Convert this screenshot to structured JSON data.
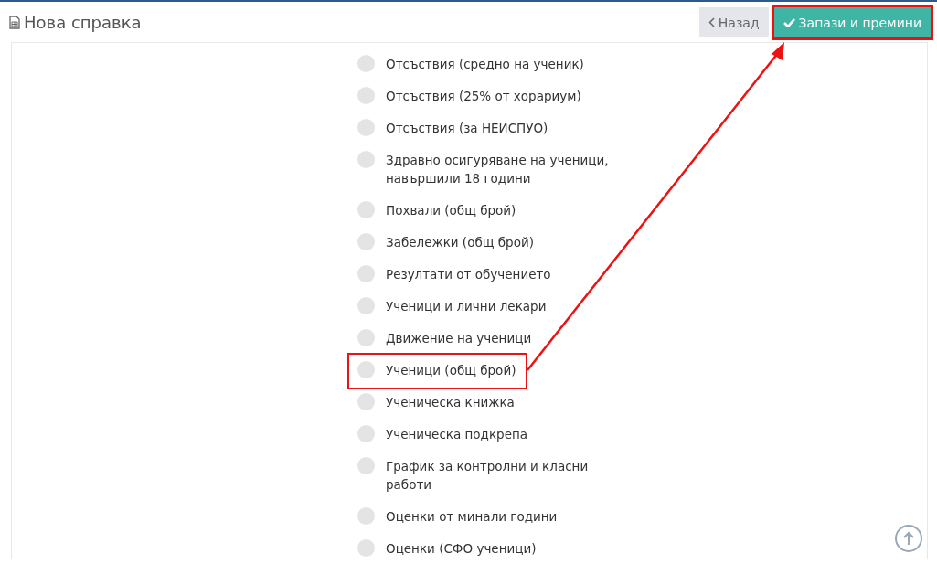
{
  "page": {
    "title": "Нова справка"
  },
  "buttons": [
    {
      "kind": "back",
      "label": "Назад",
      "highlighted": false
    },
    {
      "kind": "save",
      "label": "Запази и премини",
      "highlighted": true
    }
  ],
  "options": [
    {
      "label": "Отсъствия (средно на ученик)",
      "selected": false,
      "highlighted": false
    },
    {
      "label": "Отсъствия (25% от хорариум)",
      "selected": false,
      "highlighted": false
    },
    {
      "label": "Отсъствия (за НЕИСПУО)",
      "selected": false,
      "highlighted": false
    },
    {
      "label": "Здравно осигуряване на ученици, навършили 18 години",
      "selected": false,
      "highlighted": false
    },
    {
      "label": "Похвали (общ брой)",
      "selected": false,
      "highlighted": false
    },
    {
      "label": "Забележки (общ брой)",
      "selected": false,
      "highlighted": false
    },
    {
      "label": "Резултати от обучението",
      "selected": false,
      "highlighted": false
    },
    {
      "label": "Ученици и лични лекари",
      "selected": false,
      "highlighted": false
    },
    {
      "label": "Движение на ученици",
      "selected": false,
      "highlighted": false
    },
    {
      "label": "Ученици (общ брой)",
      "selected": false,
      "highlighted": true
    },
    {
      "label": "Ученическа книжка",
      "selected": false,
      "highlighted": false
    },
    {
      "label": "Ученическа подкрепа",
      "selected": false,
      "highlighted": false
    },
    {
      "label": "График за контролни и класни работи",
      "selected": false,
      "highlighted": false
    },
    {
      "label": "Оценки от минали години",
      "selected": false,
      "highlighted": false
    },
    {
      "label": "Оценки (СФО ученици)",
      "selected": false,
      "highlighted": false
    }
  ],
  "annotation": {
    "arrow": true
  }
}
